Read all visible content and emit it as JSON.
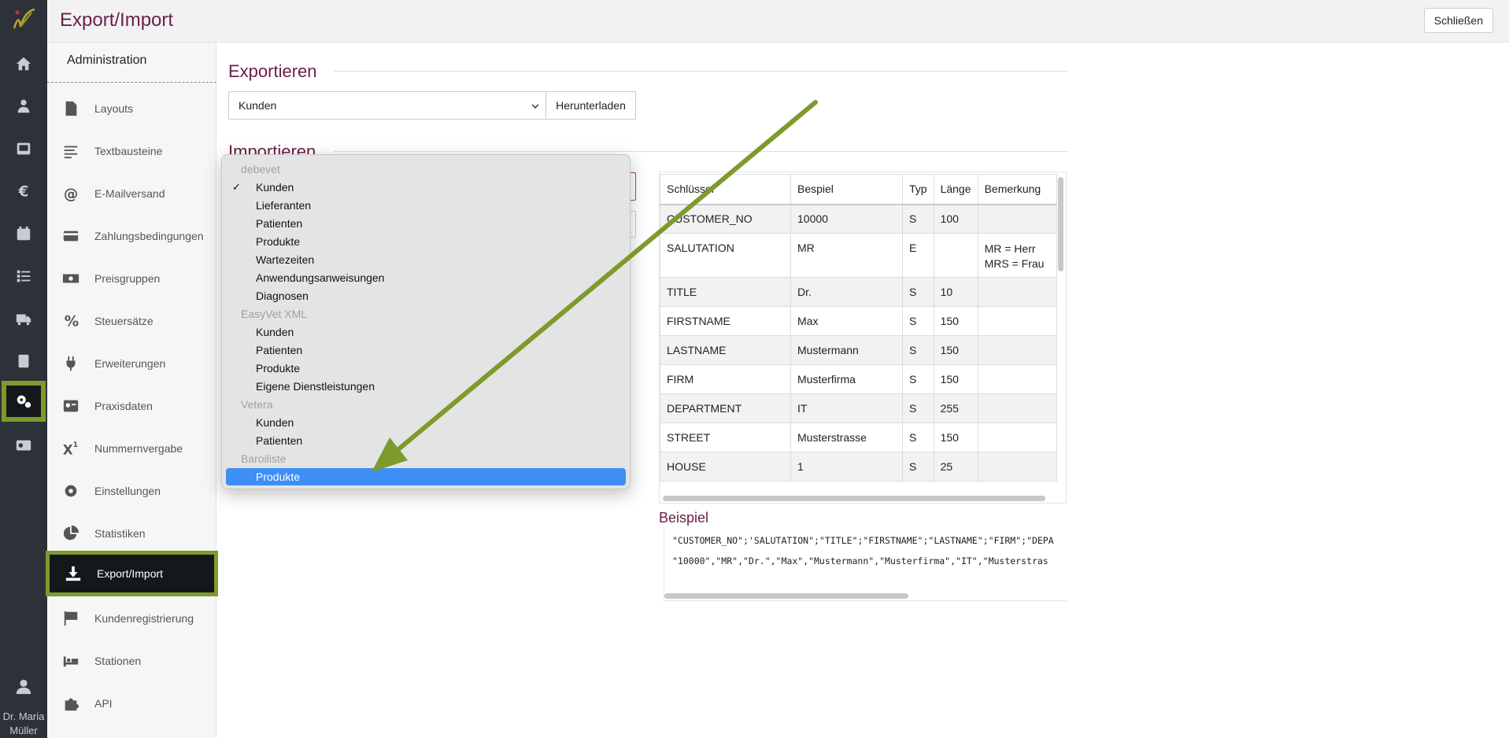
{
  "header": {
    "title": "Export/Import",
    "close_label": "Schließen"
  },
  "rail": {
    "icons": [
      "home-icon",
      "customers-icon",
      "patients-icon",
      "finance-icon",
      "calendar-icon",
      "tasks-icon",
      "delivery-icon",
      "book-icon",
      "settings-gears-icon",
      "user-admin-icon"
    ],
    "active_index": 8,
    "user_name": "Dr. Maria Müller"
  },
  "sidebar": {
    "heading": "Administration",
    "items": [
      {
        "label": "Layouts",
        "icon": "pdf-file-icon"
      },
      {
        "label": "Textbausteine",
        "icon": "text-lines-icon"
      },
      {
        "label": "E-Mailversand",
        "icon": "at-icon"
      },
      {
        "label": "Zahlungsbedingungen",
        "icon": "credit-card-icon"
      },
      {
        "label": "Preisgruppen",
        "icon": "money-bill-icon"
      },
      {
        "label": "Steuersätze",
        "icon": "percent-icon"
      },
      {
        "label": "Erweiterungen",
        "icon": "plug-icon"
      },
      {
        "label": "Praxisdaten",
        "icon": "id-card-icon"
      },
      {
        "label": "Nummernvergabe",
        "icon": "superscript-icon"
      },
      {
        "label": "Einstellungen",
        "icon": "gear-icon"
      },
      {
        "label": "Statistiken",
        "icon": "pie-chart-icon"
      },
      {
        "label": "Export/Import",
        "icon": "download-icon"
      },
      {
        "label": "Kundenregistrierung",
        "icon": "flag-checkered-icon"
      },
      {
        "label": "Stationen",
        "icon": "bed-icon"
      },
      {
        "label": "API",
        "icon": "puzzle-icon"
      }
    ],
    "active_index": 11
  },
  "export": {
    "title": "Exportieren",
    "selected": "Kunden",
    "download_label": "Herunterladen"
  },
  "import": {
    "title": "Importieren"
  },
  "dropdown": {
    "groups": [
      {
        "label": "debevet",
        "options": [
          "Kunden",
          "Lieferanten",
          "Patienten",
          "Produkte",
          "Wartezeiten",
          "Anwendungsanweisungen",
          "Diagnosen"
        ]
      },
      {
        "label": "EasyVet XML",
        "options": [
          "Kunden",
          "Patienten",
          "Produkte",
          "Eigene Dienstleistungen"
        ]
      },
      {
        "label": "Vetera",
        "options": [
          "Kunden",
          "Patienten"
        ]
      },
      {
        "label": "Baroiliste",
        "options": [
          "Produkte"
        ]
      }
    ],
    "checked": "debevet / Kunden",
    "highlighted": "Baroiliste / Produkte",
    "check_mark": "✓",
    "highlight_color": "#3d8ef6"
  },
  "table": {
    "headers": [
      "Schlüssel",
      "Bespiel",
      "Typ",
      "Länge",
      "Bemerkung"
    ],
    "rows": [
      [
        "CUSTOMER_NO",
        "10000",
        "S",
        "100",
        ""
      ],
      [
        "SALUTATION",
        "MR",
        "E",
        "",
        "MR = Herr\nMRS = Frau"
      ],
      [
        "TITLE",
        "Dr.",
        "S",
        "10",
        ""
      ],
      [
        "FIRSTNAME",
        "Max",
        "S",
        "150",
        ""
      ],
      [
        "LASTNAME",
        "Mustermann",
        "S",
        "150",
        ""
      ],
      [
        "FIRM",
        "Musterfirma",
        "S",
        "150",
        ""
      ],
      [
        "DEPARTMENT",
        "IT",
        "S",
        "255",
        ""
      ],
      [
        "STREET",
        "Musterstrasse",
        "S",
        "150",
        ""
      ],
      [
        "HOUSE",
        "1",
        "S",
        "25",
        ""
      ]
    ]
  },
  "example": {
    "title": "Beispiel",
    "line1": "\"CUSTOMER_NO\";'SALUTATION\";\"TITLE\";\"FIRSTNAME\";\"LASTNAME\";\"FIRM\";\"DEPA",
    "line2": "\"10000\",\"MR\",\"Dr.\",\"Max\",\"Mustermann\",\"Musterfirma\",\"IT\",\"Musterstras"
  },
  "colors": {
    "accent": "#6b2048",
    "highlight_border": "#7c9b2c",
    "annotation_arrow": "#7c9b2c",
    "rail_bg": "#2d3238"
  }
}
